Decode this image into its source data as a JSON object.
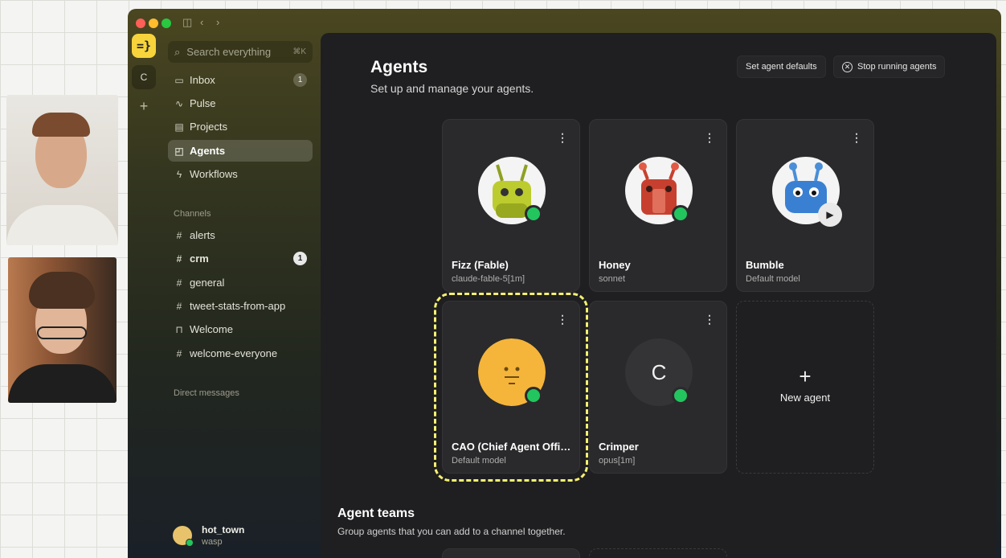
{
  "sidebar": {
    "workspace_initial": "C",
    "search_placeholder": "Search everything",
    "search_shortcut": "⌘K",
    "nav": [
      {
        "label": "Inbox",
        "badge": "1"
      },
      {
        "label": "Pulse"
      },
      {
        "label": "Projects"
      },
      {
        "label": "Agents"
      },
      {
        "label": "Workflows"
      }
    ],
    "channels_label": "Channels",
    "channels": [
      {
        "label": "alerts"
      },
      {
        "label": "crm",
        "badge": "1"
      },
      {
        "label": "general"
      },
      {
        "label": "tweet-stats-from-app"
      },
      {
        "label": "Welcome"
      },
      {
        "label": "welcome-everyone"
      }
    ],
    "dm_label": "Direct messages",
    "user": {
      "name": "hot_town",
      "sub": "wasp"
    }
  },
  "main": {
    "title": "Agents",
    "subtitle": "Set up and manage your agents.",
    "set_defaults_label": "Set agent defaults",
    "stop_label": "Stop running agents",
    "agents": [
      {
        "name": "Fizz (Fable)",
        "model": "claude-fable-5[1m]",
        "color": "#c9d63a"
      },
      {
        "name": "Honey",
        "model": "sonnet",
        "color": "#d54a3a"
      },
      {
        "name": "Bumble",
        "model": "Default model",
        "color": "#3f86d6"
      },
      {
        "name": "CAO (Chief Agent Offic...",
        "model": "Default model",
        "color": "#f5b53a"
      },
      {
        "name": "Crimper",
        "model": "opus[1m]",
        "initial": "C"
      }
    ],
    "new_agent_label": "New agent",
    "teams_title": "Agent teams",
    "teams_subtitle": "Group agents that you can add to a channel together."
  }
}
